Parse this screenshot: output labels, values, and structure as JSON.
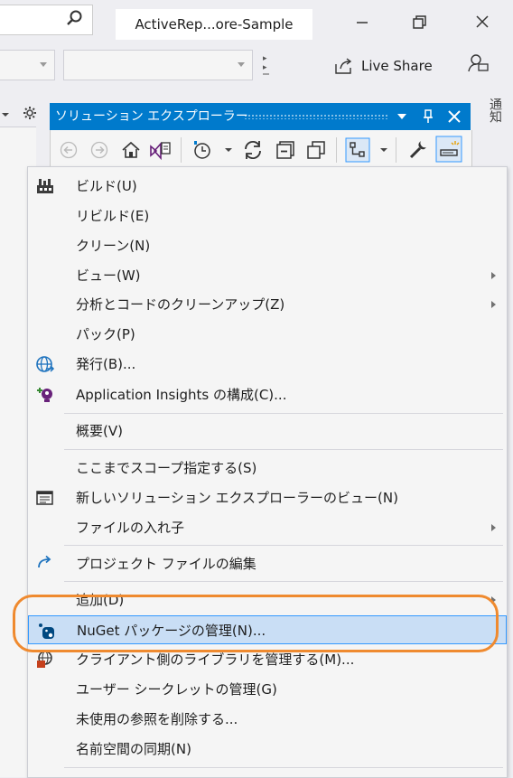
{
  "window": {
    "title": "ActiveRep...ore-Sample",
    "live_share_label": "Live Share"
  },
  "solution_explorer": {
    "title": "ソリューション エクスプローラー"
  },
  "notifications": {
    "label": "通知"
  },
  "context_menu": {
    "items": [
      {
        "label": "ビルド(U)",
        "icon": "build-icon"
      },
      {
        "label": "リビルド(E)"
      },
      {
        "label": "クリーン(N)"
      },
      {
        "label": "ビュー(W)",
        "submenu": true
      },
      {
        "label": "分析とコードのクリーンアップ(Z)",
        "submenu": true
      },
      {
        "label": "パック(P)"
      },
      {
        "label": "発行(B)...",
        "icon": "globe-publish-icon"
      },
      {
        "label": "Application Insights の構成(C)...",
        "icon": "app-insights-icon"
      },
      {
        "label": "概要(V)"
      },
      {
        "label": "ここまでスコープ指定する(S)"
      },
      {
        "label": "新しいソリューション エクスプローラーのビュー(N)",
        "icon": "new-view-icon"
      },
      {
        "label": "ファイルの入れ子",
        "submenu": true
      },
      {
        "label": "プロジェクト ファイルの編集",
        "icon": "edit-project-icon"
      },
      {
        "label": "追加(D)",
        "submenu": true
      },
      {
        "label": "NuGet パッケージの管理(N)...",
        "icon": "nuget-icon",
        "selected": true
      },
      {
        "label": "クライアント側のライブラリを管理する(M)...",
        "icon": "client-library-icon"
      },
      {
        "label": "ユーザー シークレットの管理(G)"
      },
      {
        "label": "未使用の参照を削除する..."
      },
      {
        "label": "名前空間の同期(N)"
      }
    ]
  },
  "colors": {
    "accent": "#007acc",
    "selection": "#c9def5",
    "highlight_ring": "#ef8a2f"
  }
}
